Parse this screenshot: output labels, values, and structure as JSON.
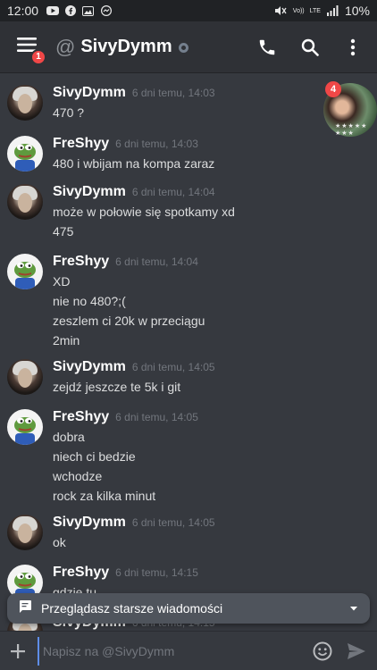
{
  "status_bar": {
    "time": "12:00",
    "network_volte": "Vo))",
    "network_lte": "LTE",
    "carrier_lte": "LTE",
    "battery": "10%"
  },
  "header": {
    "menu_badge": "1",
    "at_symbol": "@",
    "title": "SivyDymm"
  },
  "chat_head": {
    "badge": "4",
    "caption": "★★★★★ ★★★"
  },
  "messages": [
    {
      "author": "SivyDymm",
      "timestamp": "6 dni temu, 14:03",
      "lines": [
        "470 ?"
      ]
    },
    {
      "author": "FreShyy",
      "timestamp": "6 dni temu, 14:03",
      "lines": [
        "480 i wbijam na kompa zaraz"
      ]
    },
    {
      "author": "SivyDymm",
      "timestamp": "6 dni temu, 14:04",
      "lines": [
        "może w połowie się spotkamy xd",
        "475"
      ]
    },
    {
      "author": "FreShyy",
      "timestamp": "6 dni temu, 14:04",
      "lines": [
        "XD",
        "nie no 480?;(",
        "zeszlem ci 20k w przeciągu",
        "2min"
      ]
    },
    {
      "author": "SivyDymm",
      "timestamp": "6 dni temu, 14:05",
      "lines": [
        "zejdź jeszcze te 5k i git"
      ]
    },
    {
      "author": "FreShyy",
      "timestamp": "6 dni temu, 14:05",
      "lines": [
        "dobra",
        "niech ci bedzie",
        "wchodze",
        "rock za kilka minut"
      ]
    },
    {
      "author": "SivyDymm",
      "timestamp": "6 dni temu, 14:05",
      "lines": [
        "ok"
      ]
    },
    {
      "author": "FreShyy",
      "timestamp": "6 dni temu, 14:15",
      "lines": [
        "gdzie tu"
      ]
    },
    {
      "author": "SivyDymm",
      "timestamp": "6 dni temu, 14:15",
      "lines": []
    }
  ],
  "older_banner": {
    "text": "Przeglądasz starsze wiadomości"
  },
  "input": {
    "placeholder": "Napisz na @SivyDymm"
  },
  "colors": {
    "background": "#36393f",
    "header": "#2f3136",
    "badge": "#f04747",
    "banner": "#4f545c"
  }
}
